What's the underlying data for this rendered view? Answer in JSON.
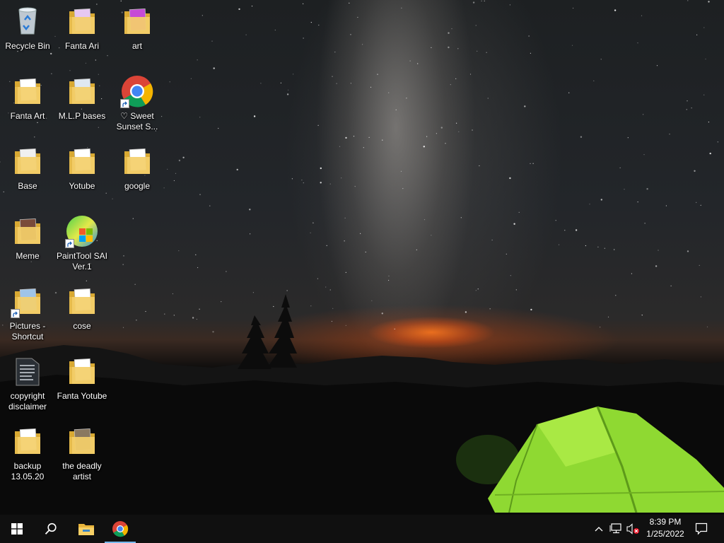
{
  "desktop": {
    "icons": [
      {
        "label": "Recycle Bin",
        "icon": "recycle-bin-icon"
      },
      {
        "label": "Fanta Ari",
        "icon": "folder-icon"
      },
      {
        "label": "art",
        "icon": "folder-icon"
      },
      {
        "label": "Fanta Art",
        "icon": "folder-icon"
      },
      {
        "label": "M.L.P bases",
        "icon": "folder-icon"
      },
      {
        "label": "♡ Sweet Sunset S...",
        "icon": "chrome-icon"
      },
      {
        "label": "Base",
        "icon": "folder-icon"
      },
      {
        "label": "Yotube",
        "icon": "folder-icon"
      },
      {
        "label": "google",
        "icon": "folder-icon"
      },
      {
        "label": "Meme",
        "icon": "folder-icon"
      },
      {
        "label": "PaintTool SAI Ver.1",
        "icon": "painttool-sai-icon"
      },
      {
        "label": "Pictures - Shortcut",
        "icon": "folder-icon"
      },
      {
        "label": "cose",
        "icon": "folder-icon"
      },
      {
        "label": "copyright disclaimer",
        "icon": "document-icon"
      },
      {
        "label": "Fanta Yotube",
        "icon": "folder-icon"
      },
      {
        "label": "backup 13.05.20",
        "icon": "folder-icon"
      },
      {
        "label": "the deadly artist",
        "icon": "folder-icon"
      }
    ]
  },
  "taskbar": {
    "start": "windows-start-icon",
    "search": "search-icon",
    "pinned": [
      "file-explorer-icon",
      "chrome-icon"
    ],
    "tray": [
      "chevron-up-icon",
      "network-icon",
      "volume-muted-icon"
    ],
    "time": "8:39 PM",
    "date": "1/25/2022",
    "notifications": "notification-icon"
  },
  "colors": {
    "folder": "#f4cf6a",
    "folder_dark": "#d9a932",
    "taskbar": "#101010",
    "accent": "#76b9ed",
    "tent": "#9be43a"
  }
}
